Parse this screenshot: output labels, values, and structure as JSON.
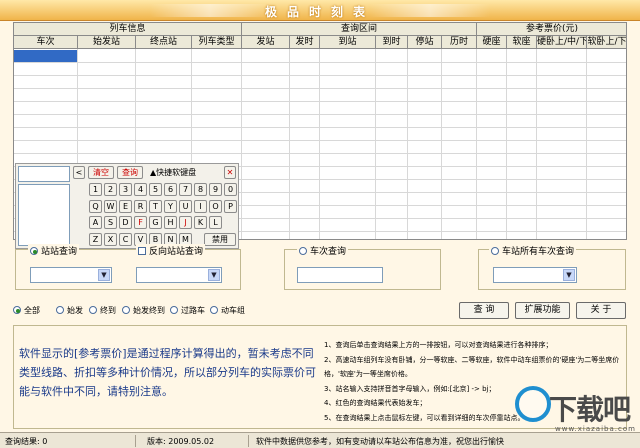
{
  "window": {
    "title": "极品时刻表"
  },
  "table": {
    "group_headers": [
      "列车信息",
      "查询区间",
      "参考票价(元)"
    ],
    "columns": [
      "车次",
      "始发站",
      "终点站",
      "列车类型",
      "发站",
      "发时",
      "到站",
      "到时",
      "停站",
      "历时",
      "硬座",
      "软座",
      "硬卧上/中/下",
      "软卧上/下"
    ]
  },
  "keyboard": {
    "prev_label": "<",
    "clear_label": "清空",
    "query_label": "查询",
    "shortcut_label": "▲快捷软键盘",
    "close_label": "✕",
    "row1": [
      "1",
      "2",
      "3",
      "4",
      "5",
      "6",
      "7",
      "8",
      "9",
      "0"
    ],
    "row2": [
      "Q",
      "W",
      "E",
      "R",
      "T",
      "Y",
      "U",
      "I",
      "O",
      "P"
    ],
    "row3": [
      "A",
      "S",
      "D",
      "F",
      "G",
      "H",
      "J",
      "K",
      "L"
    ],
    "row4": [
      "Z",
      "X",
      "C",
      "V",
      "B",
      "N",
      "M"
    ],
    "disable_label": "禁用"
  },
  "station_query": {
    "label": "站站查询",
    "reverse_label": "反向站站查询"
  },
  "train_query": {
    "label": "车次查询"
  },
  "all_trains_query": {
    "label": "车站所有车次查询"
  },
  "filters": [
    "全部",
    "始发",
    "终到",
    "始发终到",
    "过路车",
    "动车组"
  ],
  "buttons": {
    "query": "查  询",
    "extend": "扩展功能",
    "about": "关  于"
  },
  "info": {
    "main_text": "软件显示的[参考票价]是通过程序计算得出的，暂未考虑不同类型线路、折扣等多种计价情况，所以部分列车的实际票价可能与软件中不同，请特别注意。",
    "notes": [
      "1、查询后单击查询结果上方的一排按钮，可以对查询结果进行各种排序；",
      "2、高速动车组列车没有卧铺，分一等软座、二等软座，软件中动车组票价的'硬座'为二等坐席价格，'软座'为一等坐席价格。",
      "3、站名输入支持拼音首字母输入，例如:[北京] -> bj；",
      "4、红色的查询结果代表始发车；",
      "5、在查询结果上点击鼠标左键，可以看到详细的车次停靠站点。"
    ]
  },
  "status": {
    "result": "查询结果: 0",
    "version": "版本: 2009.05.02",
    "notice": "软件中数据供您参考，如有变动请以车站公布信息为准，祝您出行愉快"
  },
  "watermark": {
    "text": "下载吧",
    "sub": "www.xiazaiba.com"
  }
}
